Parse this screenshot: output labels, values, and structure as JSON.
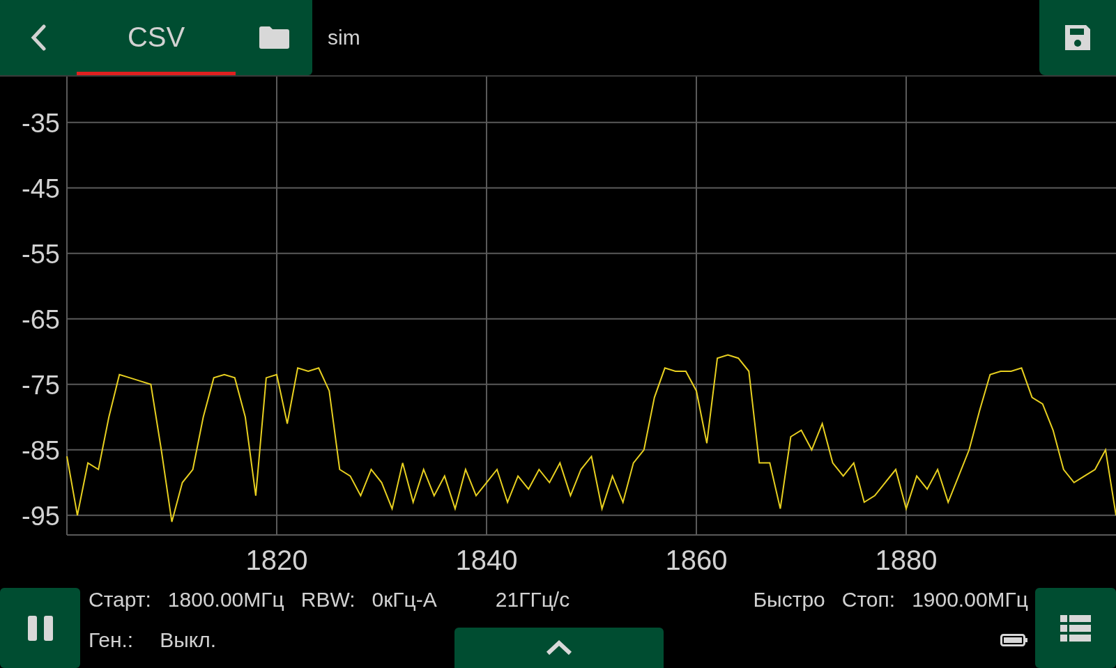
{
  "header": {
    "tabs": [
      {
        "label": "CSV",
        "selected": true
      }
    ],
    "file_name": "sim"
  },
  "chart": {
    "chart_data": {
      "type": "line",
      "grid": true,
      "xlim": [
        1800,
        1900
      ],
      "ylim": [
        -98,
        -28
      ],
      "xticks": [
        1820,
        1840,
        1860,
        1880
      ],
      "yticks": [
        -35,
        -45,
        -55,
        -65,
        -75,
        -85,
        -95
      ],
      "x": [
        1800,
        1801,
        1802,
        1803,
        1804,
        1805,
        1806,
        1807,
        1808,
        1809,
        1810,
        1811,
        1812,
        1813,
        1814,
        1815,
        1816,
        1817,
        1818,
        1819,
        1820,
        1821,
        1822,
        1823,
        1824,
        1825,
        1826,
        1827,
        1828,
        1829,
        1830,
        1831,
        1832,
        1833,
        1834,
        1835,
        1836,
        1837,
        1838,
        1839,
        1840,
        1841,
        1842,
        1843,
        1844,
        1845,
        1846,
        1847,
        1848,
        1849,
        1850,
        1851,
        1852,
        1853,
        1854,
        1855,
        1856,
        1857,
        1858,
        1859,
        1860,
        1861,
        1862,
        1863,
        1864,
        1865,
        1866,
        1867,
        1868,
        1869,
        1870,
        1871,
        1872,
        1873,
        1874,
        1875,
        1876,
        1877,
        1878,
        1879,
        1880,
        1881,
        1882,
        1883,
        1884,
        1885,
        1886,
        1887,
        1888,
        1889,
        1890,
        1891,
        1892,
        1893,
        1894,
        1895,
        1896,
        1897,
        1898,
        1899,
        1900
      ],
      "series": [
        {
          "color": "#e8d020",
          "values": [
            -86,
            -95,
            -87,
            -88,
            -80,
            -73.5,
            -74,
            -74.5,
            -75,
            -85,
            -96,
            -90,
            -88,
            -80,
            -74,
            -73.5,
            -74,
            -80,
            -92,
            -74,
            -73.5,
            -81,
            -72.5,
            -73,
            -72.5,
            -76,
            -88,
            -89,
            -92,
            -88,
            -90,
            -94,
            -87,
            -93,
            -88,
            -92,
            -89,
            -94,
            -88,
            -92,
            -90,
            -88,
            -93,
            -89,
            -91,
            -88,
            -90,
            -87,
            -92,
            -88,
            -86,
            -94,
            -89,
            -93,
            -87,
            -85,
            -77,
            -72.5,
            -73,
            -73,
            -76,
            -84,
            -71,
            -70.5,
            -71,
            -73,
            -87,
            -87,
            -94,
            -83,
            -82,
            -85,
            -81,
            -87,
            -89,
            -87,
            -93,
            -92,
            -90,
            -88,
            -94,
            -89,
            -91,
            -88,
            -93,
            -89,
            -85,
            -79,
            -73.5,
            -73,
            -73,
            -72.5,
            -77,
            -78,
            -82,
            -88,
            -90,
            -89,
            -88,
            -85,
            -95
          ]
        }
      ]
    }
  },
  "status": {
    "row_1_left": [
      "Старт:",
      "1800.00МГц",
      "RBW:",
      "0кГц-А",
      "21ГГц/с"
    ],
    "row_1_right": [
      "Быстро",
      "Стоп:",
      "1900.00МГц"
    ],
    "row_2": [
      "Ген.:",
      "Выкл."
    ]
  }
}
